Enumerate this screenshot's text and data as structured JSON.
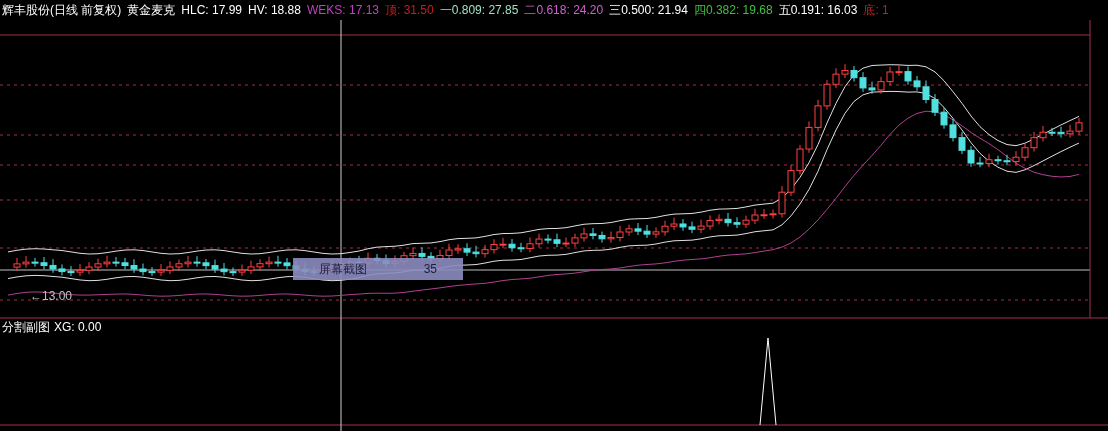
{
  "header": {
    "title": "辉丰股份(日线 前复权)",
    "indicator": "黄金麦克",
    "values": [
      {
        "text": "HLC: 17.99",
        "color": "#ffffff"
      },
      {
        "text": "HV: 18.88",
        "color": "#ffffff"
      },
      {
        "text": "WEKS: 17.13",
        "color": "#c040c0"
      },
      {
        "text": "顶: 31.50",
        "color": "#c02020"
      },
      {
        "text": "一0.809: 27.85",
        "color": "#a0e0c0"
      },
      {
        "text": "二0.618: 24.20",
        "color": "#d060d0"
      },
      {
        "text": "三0.500: 21.94",
        "color": "#ffffff"
      },
      {
        "text": "四0.382: 19.68",
        "color": "#40c040"
      },
      {
        "text": "五0.191: 16.03",
        "color": "#ffffff"
      },
      {
        "text": "底: 1",
        "color": "#c02020"
      }
    ]
  },
  "price_marker": {
    "text": "←13.00"
  },
  "crosshair_tooltip": {
    "label": "屏幕截图",
    "value": "35"
  },
  "sub_panel": {
    "title": "分割副图",
    "values": [
      {
        "text": "XG: 0.00",
        "color": "#ffffff"
      }
    ]
  }
}
